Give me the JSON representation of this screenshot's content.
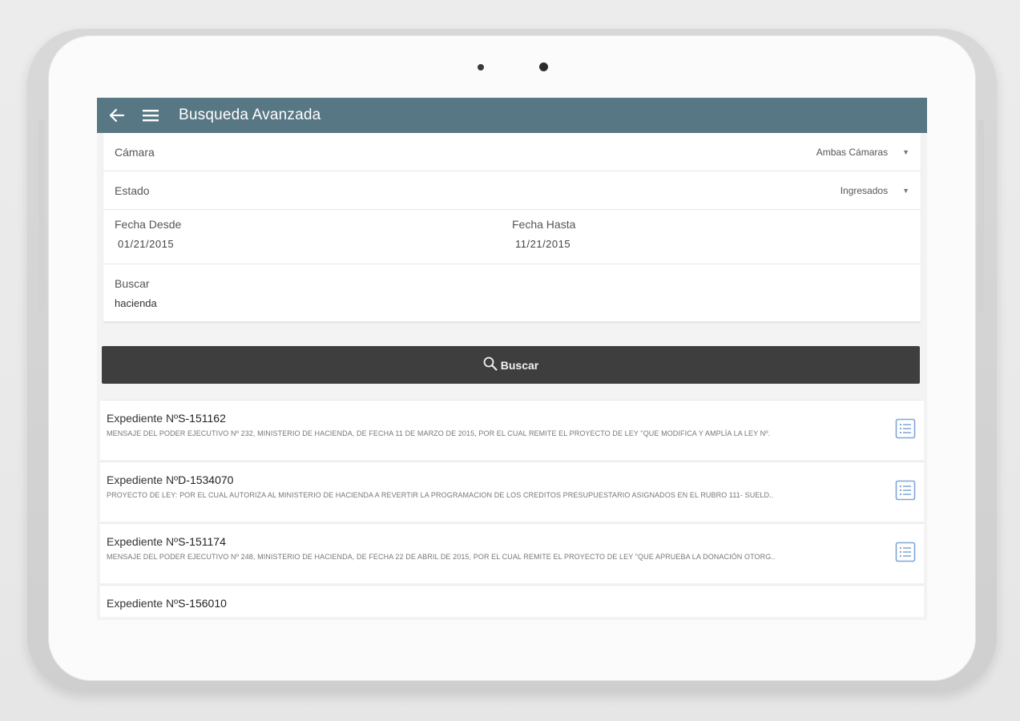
{
  "appbar": {
    "title": "Busqueda Avanzada",
    "back_icon": "arrow-left-icon",
    "menu_icon": "hamburger-menu-icon"
  },
  "form": {
    "camara": {
      "label": "Cámara",
      "value": "Ambas Cámaras"
    },
    "estado": {
      "label": "Estado",
      "value": "Ingresados"
    },
    "fecha_desde": {
      "label": "Fecha Desde",
      "value": "01/21/2015"
    },
    "fecha_hasta": {
      "label": "Fecha Hasta",
      "value": "11/21/2015"
    },
    "buscar": {
      "label": "Buscar",
      "value": "hacienda"
    }
  },
  "search_button": {
    "label": "Buscar",
    "icon": "search-icon"
  },
  "results": [
    {
      "prefix": "Expediente Nº",
      "number": "S-151162",
      "description": "MENSAJE DEL PODER EJECUTIVO Nº 232, MINISTERIO DE HACIENDA, DE FECHA 11 DE MARZO DE 2015, POR EL CUAL REMITE EL PROYECTO DE LEY \"QUE MODIFICA Y AMPLÍA LA LEY Nº."
    },
    {
      "prefix": "Expediente Nº",
      "number": "D-1534070",
      "description": "PROYECTO DE LEY: POR EL CUAL AUTORIZA AL MINISTERIO DE HACIENDA A REVERTIR LA PROGRAMACION DE LOS CREDITOS PRESUPUESTARIO ASIGNADOS EN EL RUBRO 111- SUELD.."
    },
    {
      "prefix": "Expediente Nº",
      "number": "S-151174",
      "description": "MENSAJE DEL PODER EJECUTIVO Nº 248, MINISTERIO DE HACIENDA, DE FECHA 22 DE ABRIL DE 2015, POR EL CUAL REMITE EL PROYECTO DE LEY \"QUE APRUEBA LA DONACIÓN OTORG.."
    },
    {
      "prefix": "Expediente Nº",
      "number": "S-156010",
      "description": ""
    }
  ],
  "colors": {
    "appbar": "#587784",
    "button": "#3e3e3e",
    "doc_icon": "#7fa6d6"
  }
}
